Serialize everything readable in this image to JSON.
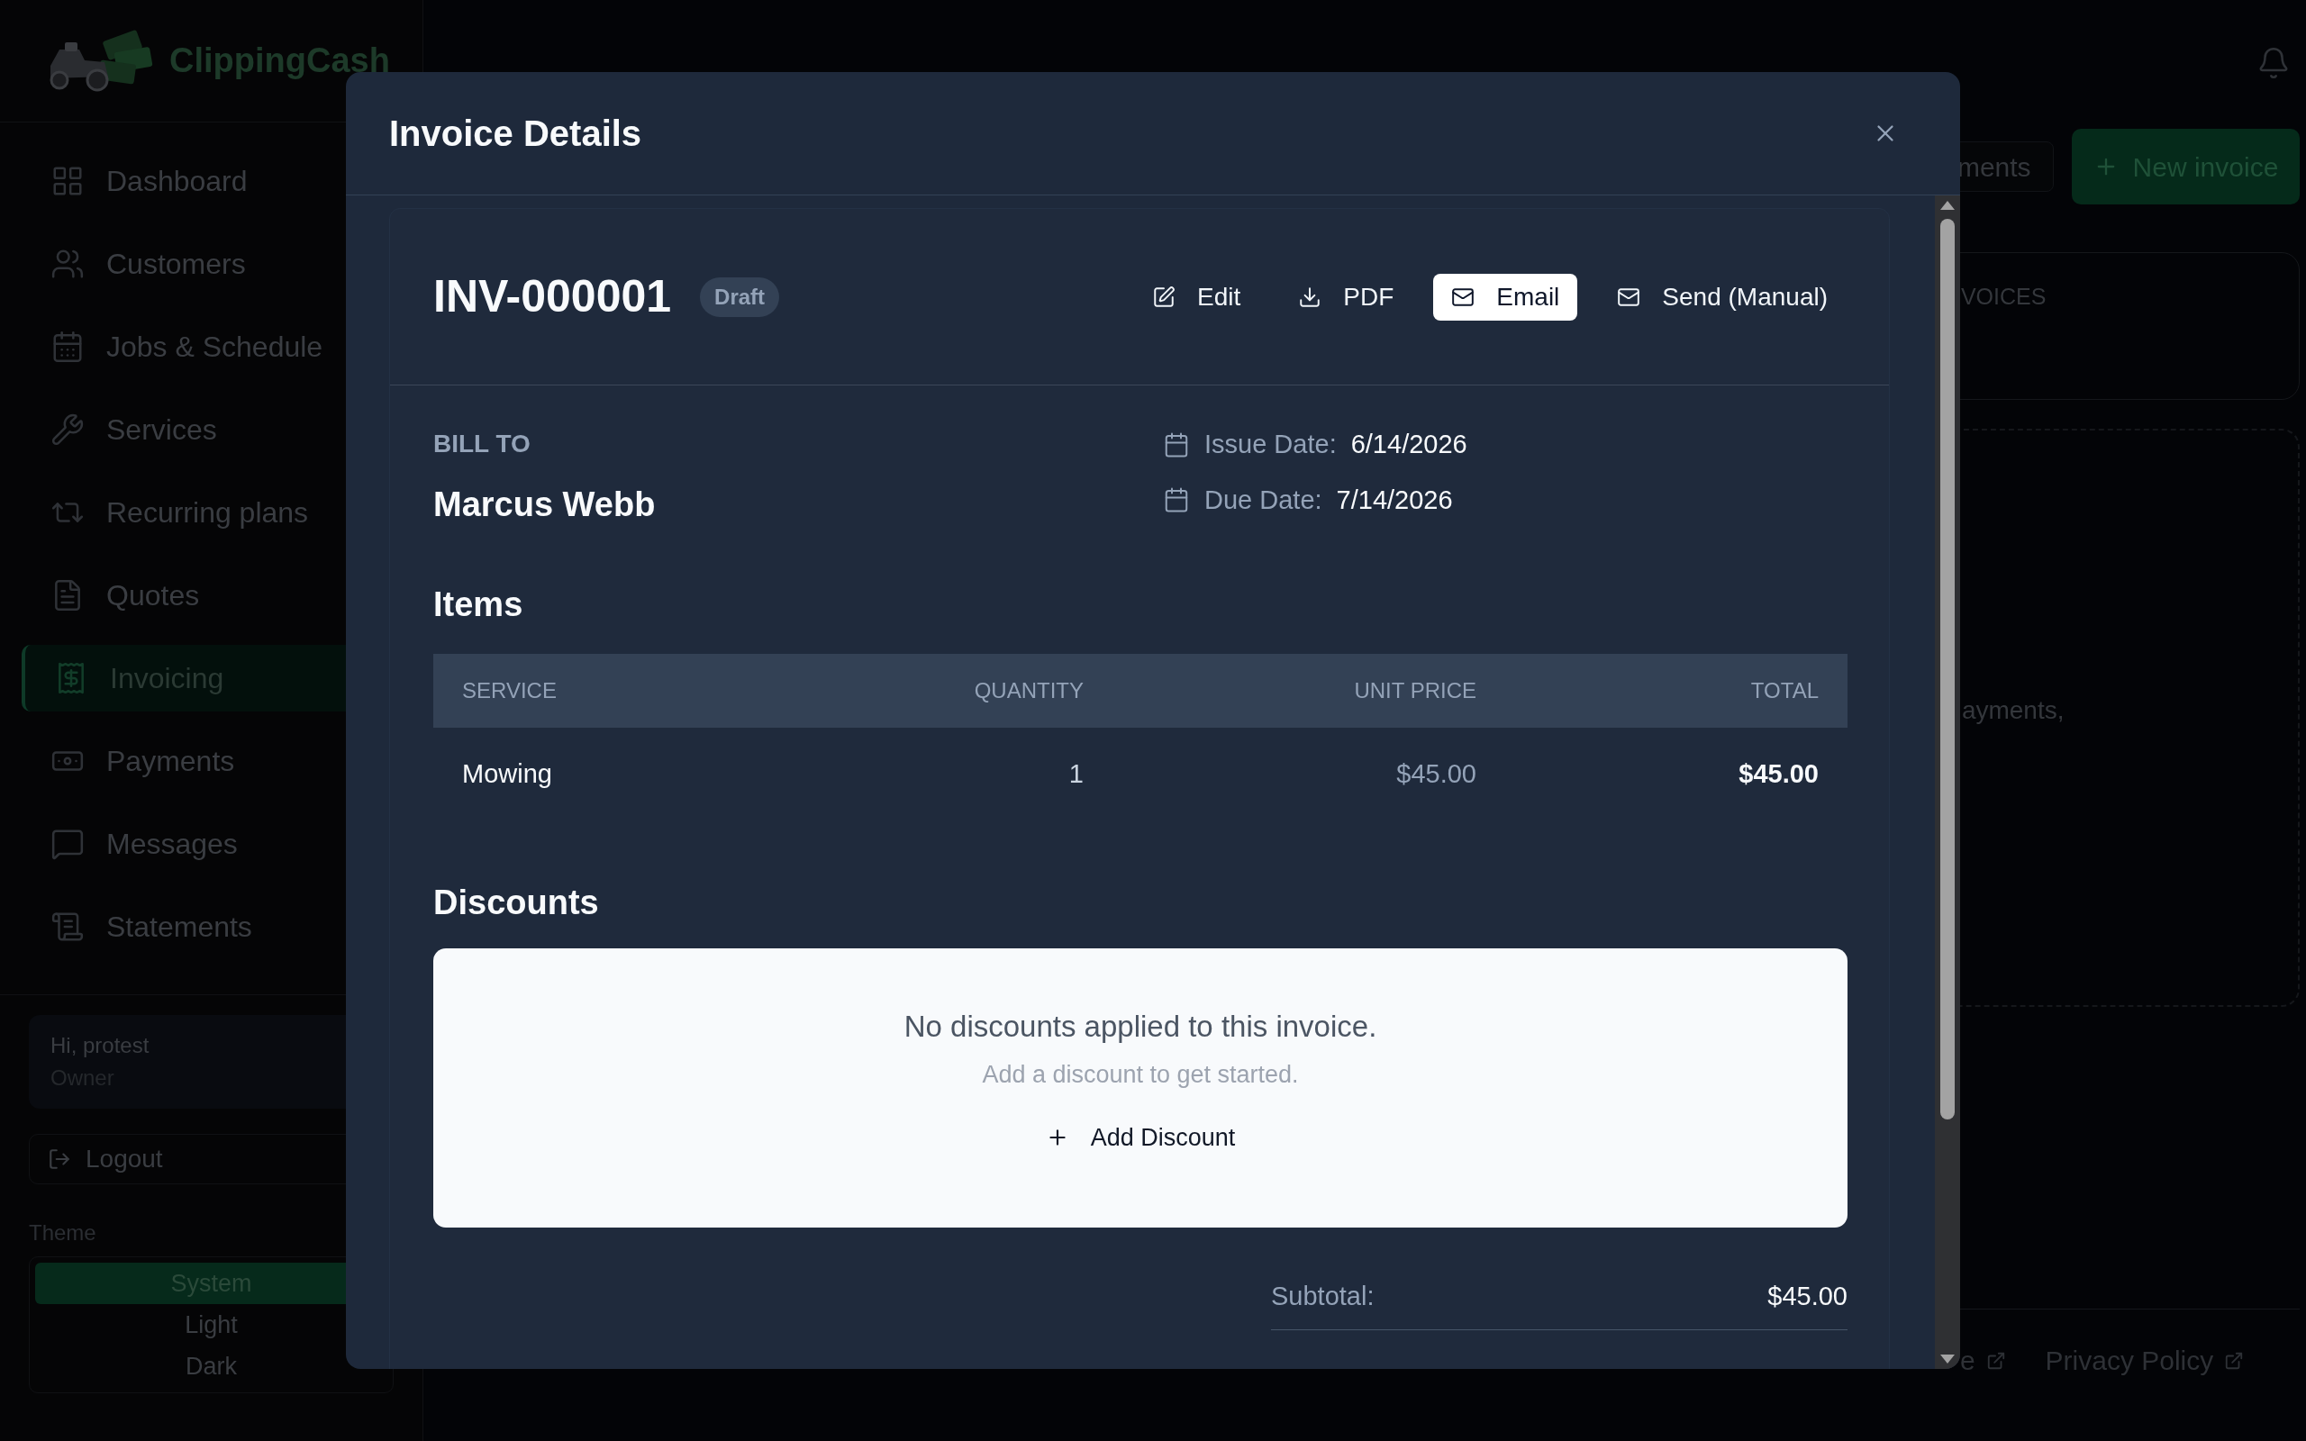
{
  "app": {
    "logo_text": "ClippingCash"
  },
  "sidebar": {
    "items": [
      {
        "label": "Dashboard",
        "selected": false
      },
      {
        "label": "Customers",
        "selected": false
      },
      {
        "label": "Jobs & Schedule",
        "selected": false
      },
      {
        "label": "Services",
        "selected": false
      },
      {
        "label": "Recurring plans",
        "selected": false
      },
      {
        "label": "Quotes",
        "selected": false
      },
      {
        "label": "Invoicing",
        "selected": true
      },
      {
        "label": "Payments",
        "selected": false
      },
      {
        "label": "Messages",
        "selected": false
      },
      {
        "label": "Statements",
        "selected": false
      }
    ],
    "user": {
      "greeting": "Hi, protest",
      "role": "Owner"
    },
    "logout": "Logout",
    "theme": {
      "label": "Theme",
      "options": [
        {
          "label": "System",
          "selected": true
        },
        {
          "label": "Light",
          "selected": false
        },
        {
          "label": "Dark",
          "selected": false
        }
      ]
    }
  },
  "header": {
    "buttons": [
      {
        "label": "ments",
        "kind": "outline"
      },
      {
        "label": "New invoice",
        "kind": "primary"
      }
    ]
  },
  "background": {
    "card_text": "VOICES",
    "empty_text": "ayments,",
    "footer_links": [
      "e",
      "Privacy Policy"
    ]
  },
  "modal": {
    "title": "Invoice Details",
    "invoice": {
      "number": "INV-000001",
      "status": "Draft",
      "actions": [
        {
          "label": "Edit",
          "kind": "edit",
          "selected": false
        },
        {
          "label": "PDF",
          "kind": "download",
          "selected": false
        },
        {
          "label": "Email",
          "kind": "mail",
          "selected": true
        },
        {
          "label": "Send (Manual)",
          "kind": "mail",
          "selected": false
        }
      ]
    },
    "bill_to": {
      "label": "BILL TO",
      "name": "Marcus Webb"
    },
    "dates": [
      {
        "label": "Issue Date:",
        "value": "6/14/2026"
      },
      {
        "label": "Due Date:",
        "value": "7/14/2026"
      }
    ],
    "items": {
      "title": "Items",
      "columns": [
        "SERVICE",
        "QUANTITY",
        "UNIT PRICE",
        "TOTAL"
      ],
      "rows": [
        {
          "service": "Mowing",
          "quantity": "1",
          "unit_price": "$45.00",
          "total": "$45.00"
        }
      ]
    },
    "discounts": {
      "title": "Discounts",
      "empty_title": "No discounts applied to this invoice.",
      "empty_hint": "Add a discount to get started.",
      "add_button": "Add Discount"
    },
    "totals": [
      {
        "label": "Subtotal:",
        "value": "$45.00"
      }
    ]
  }
}
